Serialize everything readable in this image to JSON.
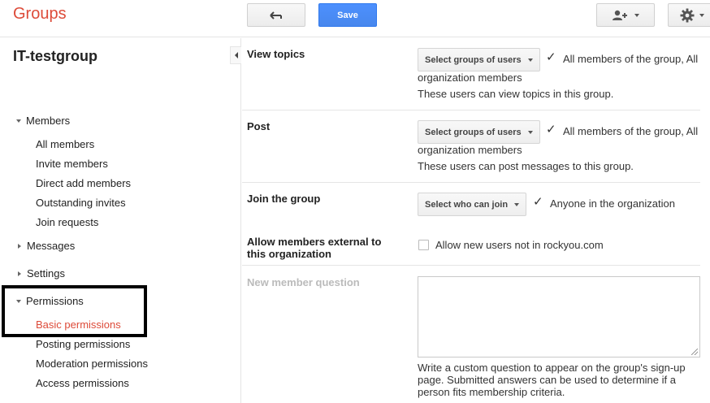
{
  "header": {
    "brand": "Groups",
    "save_label": "Save",
    "back_icon": "back-arrow-icon",
    "user_icon": "add-user-icon",
    "gear_icon": "gear-icon"
  },
  "sidebar": {
    "group_name": "IT-testgroup",
    "sections": {
      "members": "Members",
      "messages": "Messages",
      "settings": "Settings",
      "permissions": "Permissions"
    },
    "member_items": [
      "All members",
      "Invite members",
      "Direct add members",
      "Outstanding invites",
      "Join requests"
    ],
    "permission_items": [
      "Basic permissions",
      "Posting permissions",
      "Moderation permissions",
      "Access permissions"
    ],
    "active_item": "Basic permissions"
  },
  "main": {
    "view_topics": {
      "label": "View topics",
      "dropdown": "Select groups of users",
      "value_line1": "All members of the group, All",
      "value_line2": "organization members",
      "help": "These users can view topics in this group."
    },
    "post": {
      "label": "Post",
      "dropdown": "Select groups of users",
      "value_line1": "All members of the group, All",
      "value_line2": "organization members",
      "help": "These users can post messages to this group."
    },
    "join": {
      "label": "Join the group",
      "dropdown": "Select who can join",
      "value": "Anyone in the organization"
    },
    "external": {
      "label_line1": "Allow members external to",
      "label_line2": "this organization",
      "checkbox_label": "Allow new users not in rockyou.com",
      "checked": false
    },
    "question": {
      "label": "New member question",
      "value": "",
      "description": "Write a custom question to appear on the group's sign-up page. Submitted answers can be used to determine if a person fits membership criteria."
    }
  },
  "colors": {
    "brand": "#dd4b39",
    "accent": "#4d90fe",
    "active_nav": "#dd4b39"
  }
}
